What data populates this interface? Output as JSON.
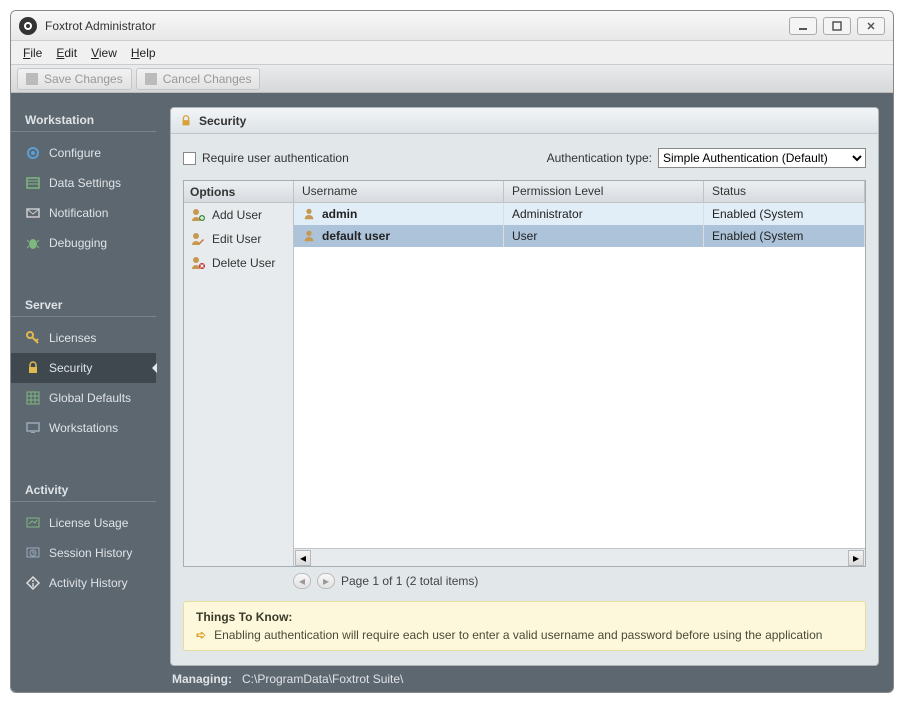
{
  "window": {
    "title": "Foxtrot Administrator"
  },
  "menubar": {
    "file": "File",
    "edit": "Edit",
    "view": "View",
    "help": "Help"
  },
  "toolbar": {
    "save": "Save Changes",
    "cancel": "Cancel Changes"
  },
  "sidebar": {
    "sections": [
      {
        "title": "Workstation",
        "items": [
          {
            "label": "Configure",
            "icon": "gear-icon"
          },
          {
            "label": "Data Settings",
            "icon": "data-icon"
          },
          {
            "label": "Notification",
            "icon": "mail-icon"
          },
          {
            "label": "Debugging",
            "icon": "bug-icon"
          }
        ]
      },
      {
        "title": "Server",
        "items": [
          {
            "label": "Licenses",
            "icon": "key-icon"
          },
          {
            "label": "Security",
            "icon": "lock-icon",
            "active": true
          },
          {
            "label": "Global Defaults",
            "icon": "grid-icon"
          },
          {
            "label": "Workstations",
            "icon": "monitor-icon"
          }
        ]
      },
      {
        "title": "Activity",
        "items": [
          {
            "label": "License Usage",
            "icon": "chart-icon"
          },
          {
            "label": "Session History",
            "icon": "history-icon"
          },
          {
            "label": "Activity History",
            "icon": "diamond-icon"
          }
        ]
      }
    ]
  },
  "panel": {
    "title": "Security",
    "require_auth_label": "Require user authentication",
    "auth_type_label": "Authentication type:",
    "auth_type_value": "Simple Authentication (Default)",
    "options_header": "Options",
    "options": [
      {
        "label": "Add User",
        "icon": "user-add-icon"
      },
      {
        "label": "Edit User",
        "icon": "user-edit-icon"
      },
      {
        "label": "Delete User",
        "icon": "user-delete-icon"
      }
    ],
    "columns": {
      "c1": "Username",
      "c2": "Permission Level",
      "c3": "Status"
    },
    "rows": [
      {
        "username": "admin",
        "permission": "Administrator",
        "status": "Enabled  (System"
      },
      {
        "username": "default user",
        "permission": "User",
        "status": "Enabled  (System"
      }
    ],
    "pager_text": "Page 1 of 1 (2 total items)"
  },
  "tips": {
    "title": "Things To Know:",
    "items": [
      "Enabling authentication will require each user to enter a valid username and password before using the application"
    ]
  },
  "statusbar": {
    "label": "Managing:",
    "path": "C:\\ProgramData\\Foxtrot Suite\\"
  }
}
